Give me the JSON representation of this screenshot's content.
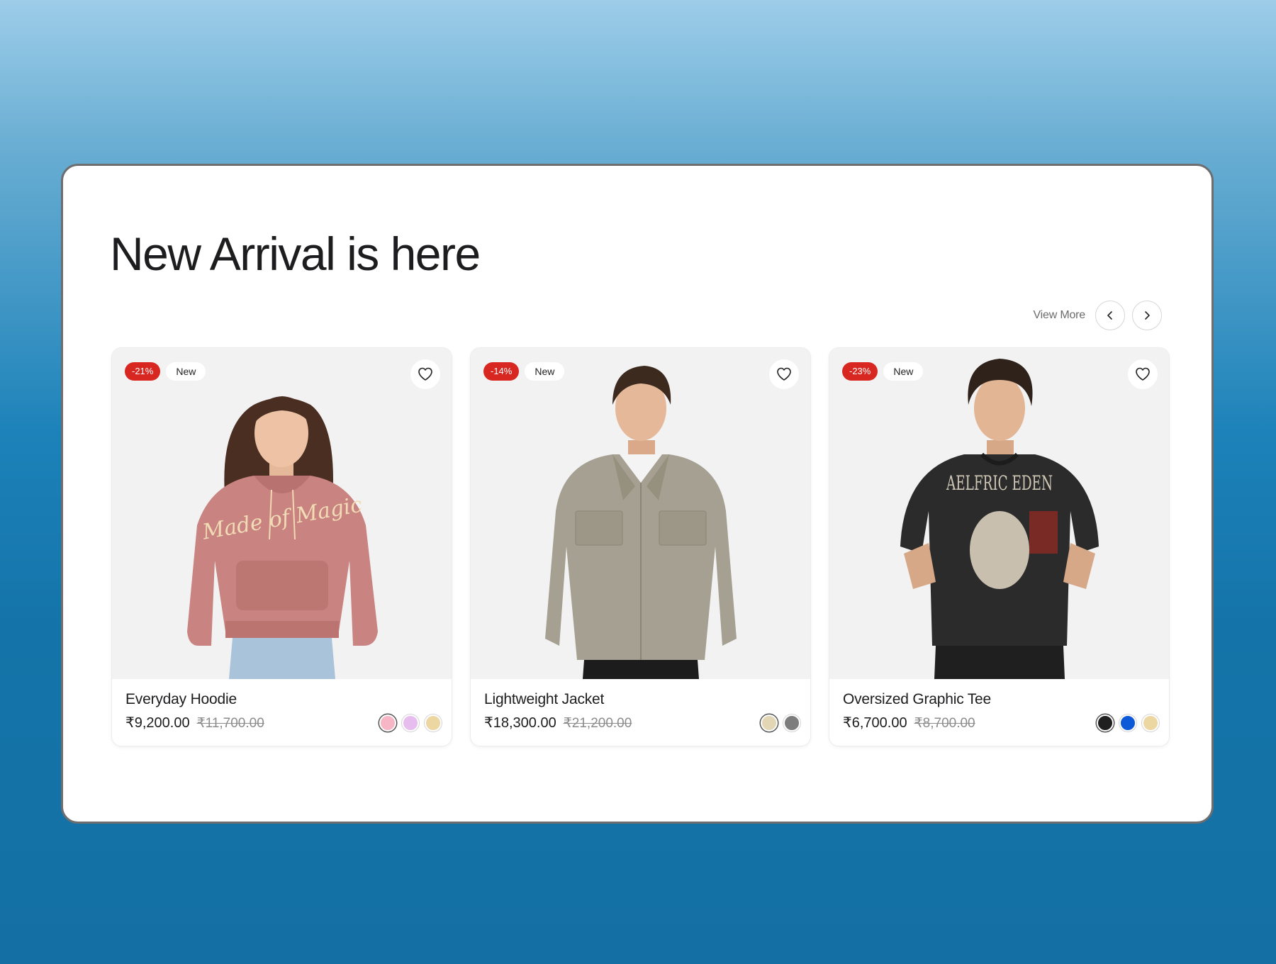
{
  "heading": "New Arrival is here",
  "controls": {
    "view_more": "View More",
    "prev_icon": "chevron-left-icon",
    "next_icon": "chevron-right-icon"
  },
  "products": [
    {
      "name": "Everyday Hoodie",
      "price": "₹9,200.00",
      "old_price": "₹11,700.00",
      "discount": "-21%",
      "tag": "New",
      "favorite_icon": "heart-icon",
      "swatches": [
        "#f7b6c6",
        "#e7bdf0",
        "#ecd6a2"
      ],
      "selected_swatch": 0
    },
    {
      "name": "Lightweight Jacket",
      "price": "₹18,300.00",
      "old_price": "₹21,200.00",
      "discount": "-14%",
      "tag": "New",
      "favorite_icon": "heart-icon",
      "swatches": [
        "#e2d6b5",
        "#7d7d7d"
      ],
      "selected_swatch": 0
    },
    {
      "name": "Oversized Graphic Tee",
      "price": "₹6,700.00",
      "old_price": "₹8,700.00",
      "discount": "-23%",
      "tag": "New",
      "favorite_icon": "heart-icon",
      "swatches": [
        "#1f1f1f",
        "#0d5ad8",
        "#ecd6a2"
      ],
      "selected_swatch": 0
    }
  ],
  "product_images": [
    {
      "print_text": "Made of Magic"
    },
    {
      "print_text": ""
    },
    {
      "print_text": "AELFRIC EDEN"
    }
  ]
}
